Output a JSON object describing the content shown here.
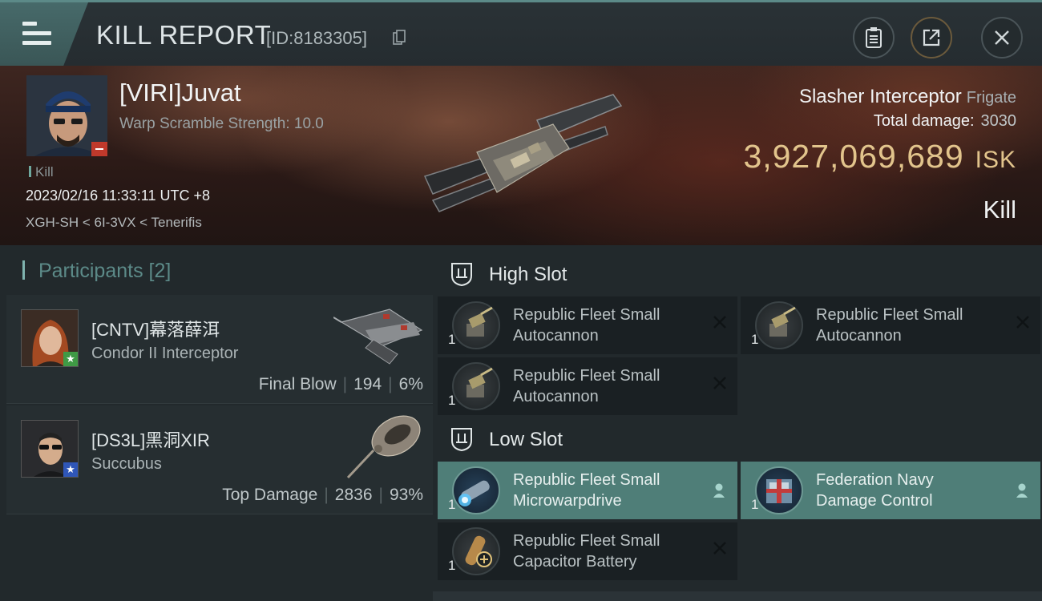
{
  "header": {
    "title": "KILL REPORT",
    "report_id": "[ID:8183305]"
  },
  "victim": {
    "pilot": "[VIRI]Juvat",
    "scramble": "Warp Scramble Strength: 10.0",
    "tag": "Kill",
    "datetime": "2023/02/16 11:33:11 UTC +8",
    "location": "XGH-SH < 6I-3VX < Tenerifis",
    "ship_name": "Slasher Interceptor",
    "ship_class": "Frigate",
    "damage_label": "Total damage:",
    "damage_value": "3030",
    "isk_value": "3,927,069,689",
    "isk_unit": "ISK",
    "result": "Kill"
  },
  "participants": {
    "heading": "Participants",
    "count": "[2]",
    "list": [
      {
        "name": "[CNTV]幕落薛洱",
        "ship": "Condor II Interceptor",
        "role": "Final Blow",
        "damage": "194",
        "percent": "6%"
      },
      {
        "name": "[DS3L]黑洞XIR",
        "ship": "Succubus",
        "role": "Top Damage",
        "damage": "2836",
        "percent": "93%"
      }
    ]
  },
  "slots": {
    "high": {
      "label": "High Slot",
      "modules": [
        {
          "name1": "Republic Fleet Small",
          "name2": "Autocannon",
          "qty": "1"
        },
        {
          "name1": "Republic Fleet Small",
          "name2": "Autocannon",
          "qty": "1"
        },
        {
          "name1": "Republic Fleet Small",
          "name2": "Autocannon",
          "qty": "1"
        }
      ]
    },
    "low": {
      "label": "Low Slot",
      "modules": [
        {
          "name1": "Republic Fleet Small",
          "name2": "Microwarpdrive",
          "qty": "1"
        },
        {
          "name1": "Federation Navy",
          "name2": "Damage Control",
          "qty": "1"
        },
        {
          "name1": "Republic Fleet Small",
          "name2": "Capacitor Battery",
          "qty": "1"
        }
      ]
    }
  },
  "colors": {
    "accent": "#5c8a88",
    "isk": "#e2c48c",
    "active_module": "#4f7e78",
    "negative_badge": "#c0392b"
  }
}
